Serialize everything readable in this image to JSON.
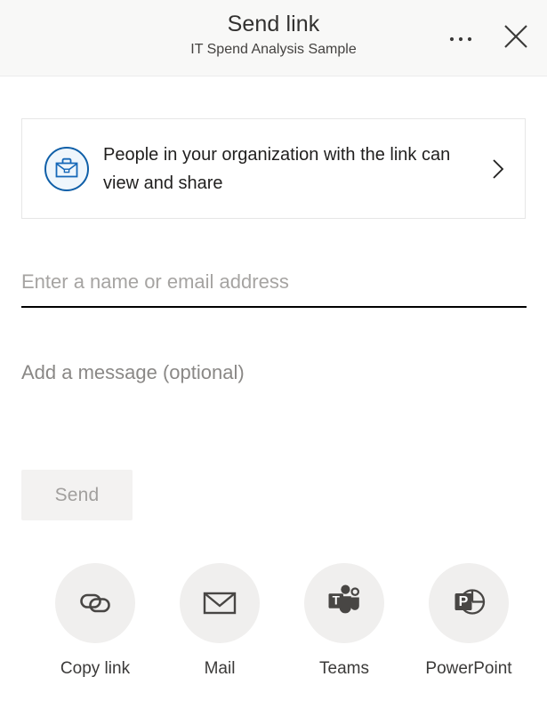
{
  "header": {
    "title": "Send link",
    "subtitle": "IT Spend Analysis Sample",
    "more_label": "···",
    "more_icon": "ellipsis-icon",
    "close_icon": "close-icon"
  },
  "permission": {
    "icon": "briefcase-icon",
    "text": "People in your organization with the link can view and share",
    "chevron_icon": "chevron-right-icon",
    "icon_color": "#1668b8",
    "icon_fill": "#eff6fc"
  },
  "recipient": {
    "placeholder": "Enter a name or email address",
    "value": ""
  },
  "message": {
    "placeholder": "Add a message (optional)",
    "value": ""
  },
  "send": {
    "label": "Send",
    "disabled": true,
    "background": "#f3f2f1",
    "text_color": "#a19f9d"
  },
  "actions": [
    {
      "label": "Copy link",
      "icon": "link-chain-icon"
    },
    {
      "label": "Mail",
      "icon": "envelope-icon"
    },
    {
      "label": "Teams",
      "icon": "microsoft-teams-icon"
    },
    {
      "label": "PowerPoint",
      "icon": "microsoft-powerpoint-icon"
    }
  ]
}
